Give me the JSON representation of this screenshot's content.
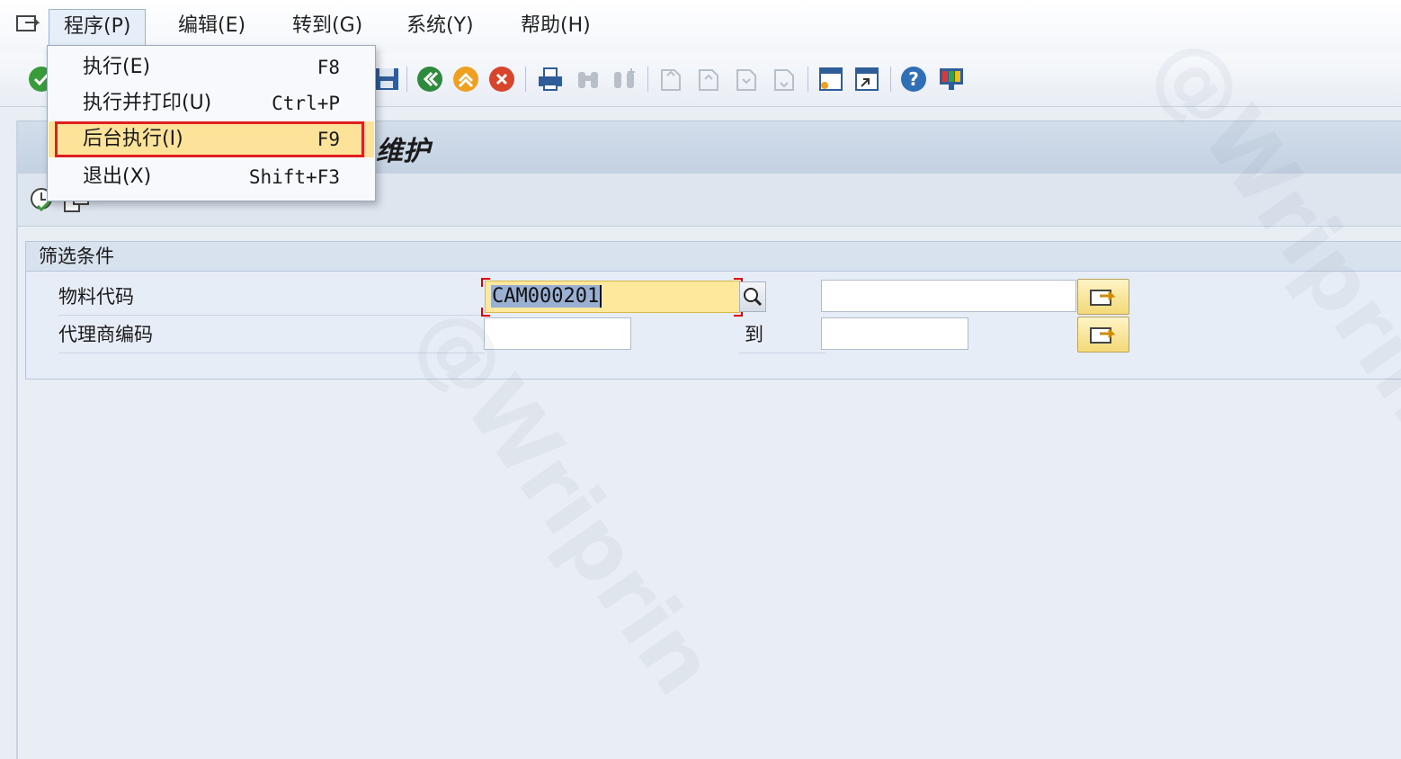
{
  "menubar": {
    "items": [
      {
        "label": "程序(P)"
      },
      {
        "label": "编辑(E)"
      },
      {
        "label": "转到(G)"
      },
      {
        "label": "系统(Y)"
      },
      {
        "label": "帮助(H)"
      }
    ]
  },
  "program_menu": {
    "items": [
      {
        "label": "执行(E)",
        "shortcut": "F8"
      },
      {
        "label": "执行并打印(U)",
        "shortcut": "Ctrl+P"
      },
      {
        "label": "后台执行(I)",
        "shortcut": "F9",
        "highlighted": true
      },
      {
        "label": "退出(X)",
        "shortcut": "Shift+F3"
      }
    ]
  },
  "title": {
    "visible_fragment_left": "",
    "visible_fragment_right": "维护"
  },
  "filter_group": {
    "title": "筛选条件",
    "rows": [
      {
        "label": "物料代码",
        "from_value": "CAM000201",
        "to_value": ""
      },
      {
        "label": "代理商编码",
        "from_value": "",
        "to_label": "到",
        "to_value": ""
      }
    ]
  },
  "watermark": "@Wriprin",
  "colors": {
    "highlight": "#fde29a",
    "annotation_box": "#e02020",
    "focused_field": "#fde89b",
    "background": "#e9eef5"
  }
}
